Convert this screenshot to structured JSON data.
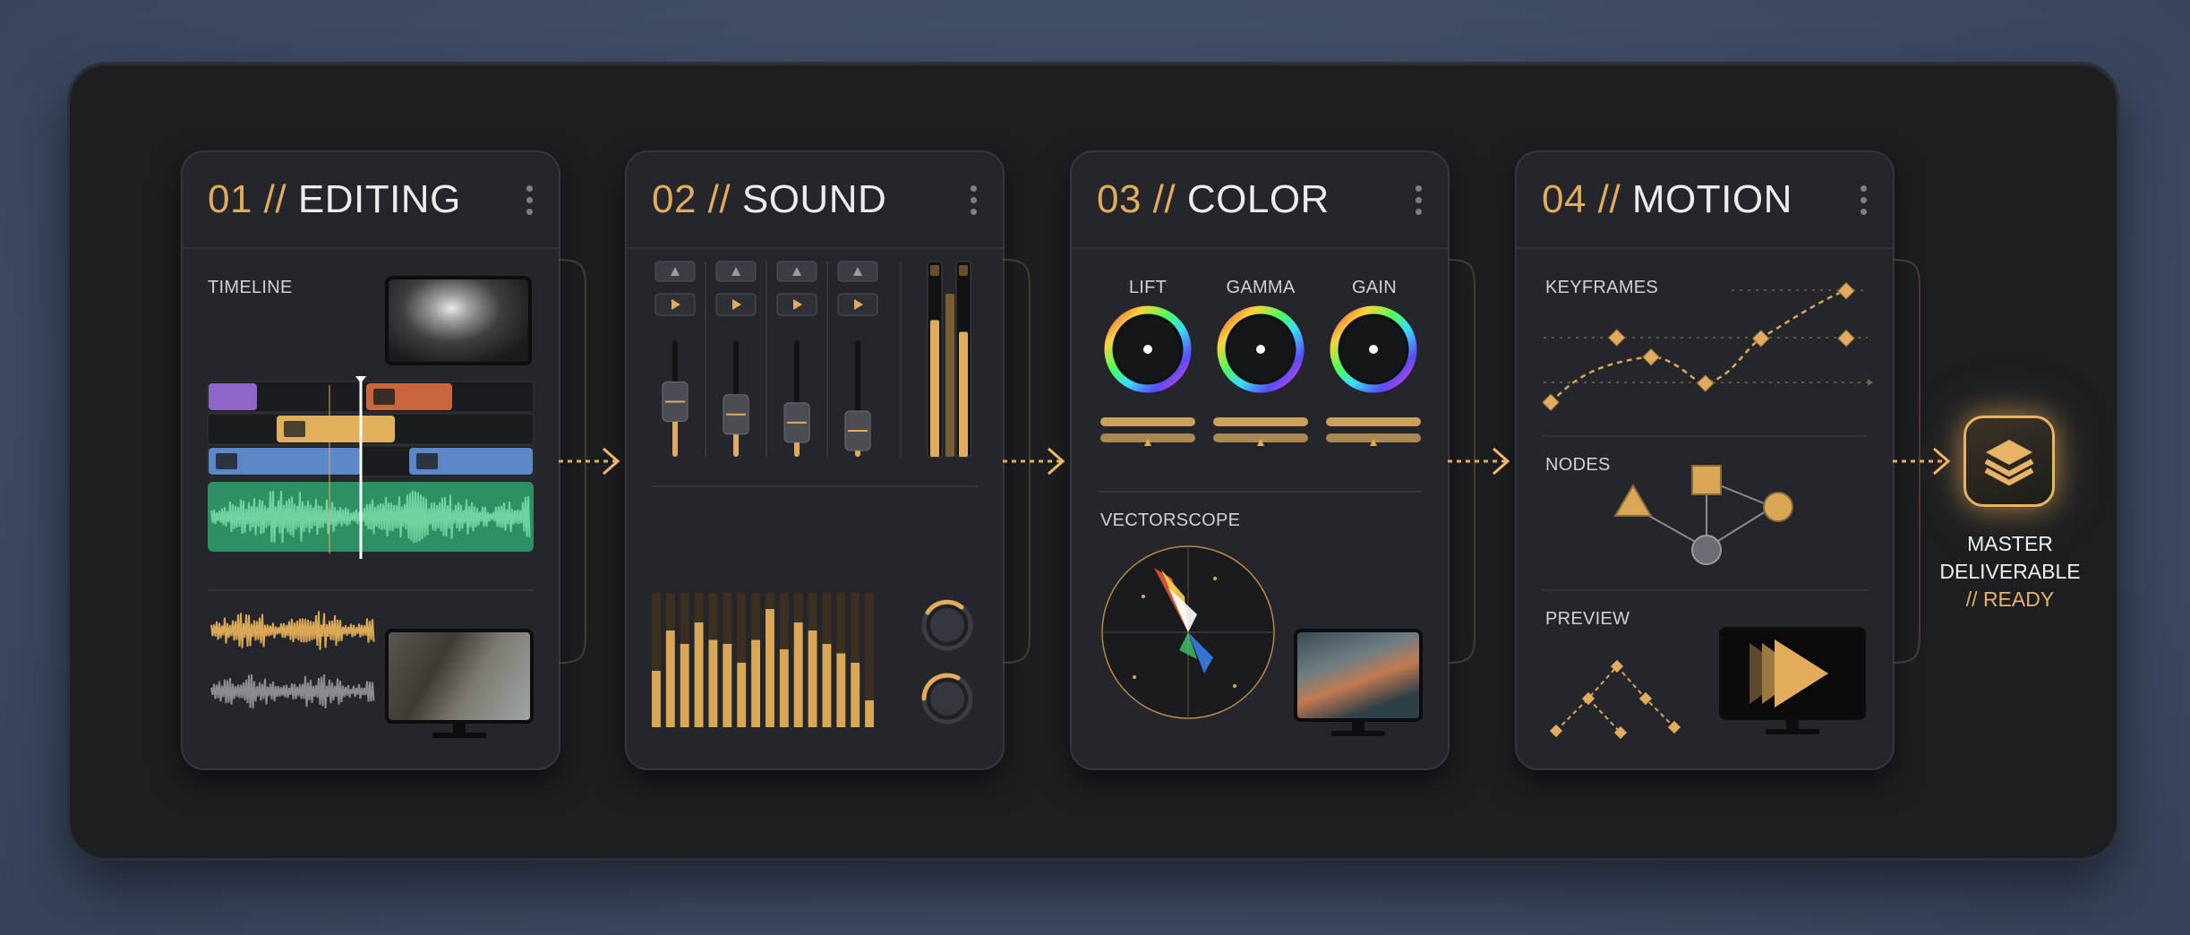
{
  "cards": [
    {
      "number": "01",
      "sep": " // ",
      "title": "EDITING",
      "labels": {
        "timeline": "TIMELINE"
      }
    },
    {
      "number": "02",
      "sep": " // ",
      "title": "SOUND"
    },
    {
      "number": "03",
      "sep": " // ",
      "title": "COLOR",
      "labels": {
        "lift": "LIFT",
        "gamma": "GAMMA",
        "gain": "GAIN",
        "vectorscope": "VECTORSCOPE"
      }
    },
    {
      "number": "04",
      "sep": " // ",
      "title": "MOTION",
      "labels": {
        "keyframes": "KEYFRAMES",
        "nodes": "NODES",
        "preview": "PREVIEW"
      }
    }
  ],
  "final": {
    "line1": "MASTER",
    "line2": "DELIVERABLE",
    "line3": "// READY",
    "icon": "layers-icon"
  },
  "mixer": {
    "fader_levels": [
      0.55,
      0.44,
      0.37,
      0.3
    ],
    "eq_bars": [
      0.42,
      0.72,
      0.62,
      0.78,
      0.65,
      0.62,
      0.48,
      0.65,
      0.88,
      0.58,
      0.78,
      0.72,
      0.62,
      0.55,
      0.48,
      0.2
    ]
  },
  "colors": {
    "accent": "#e3ac5c",
    "card_bg": "#24262b",
    "frame_bg": "#1c1e22",
    "page_bg": "#3d4a62"
  }
}
